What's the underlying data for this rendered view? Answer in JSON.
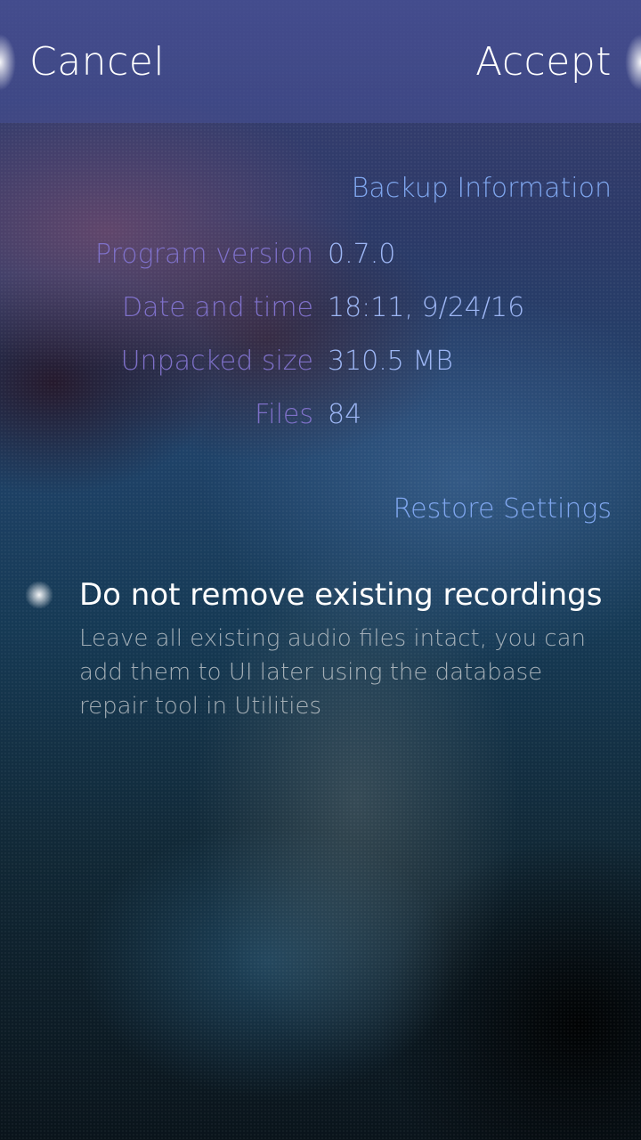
{
  "header": {
    "cancel_label": "Cancel",
    "accept_label": "Accept"
  },
  "backup_section": {
    "title": "Backup Information",
    "rows": [
      {
        "label": "Program version",
        "value": "0.7.0"
      },
      {
        "label": "Date and time",
        "value": "18:11, 9/24/16"
      },
      {
        "label": "Unpacked size",
        "value": "310.5 MB"
      },
      {
        "label": "Files",
        "value": "84"
      }
    ]
  },
  "restore_section": {
    "title": "Restore Settings",
    "option": {
      "title": "Do not remove existing recordings",
      "description": "Leave all existing audio files intact, you can add them to UI later using the database repair tool in Utilities",
      "checked": false
    }
  },
  "colors": {
    "accent": "#7fa6ee",
    "label": "#7e70c8",
    "value": "#9db6f4",
    "primary_text": "#ffffff"
  }
}
